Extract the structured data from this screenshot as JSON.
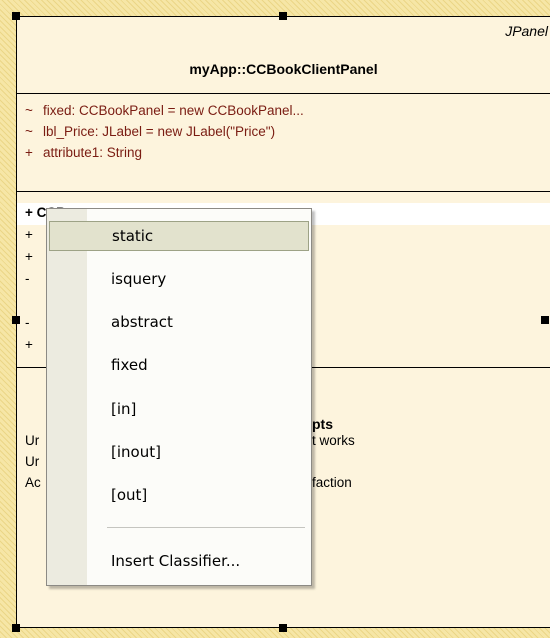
{
  "class_element": {
    "stereotype": "JPanel",
    "name": "myApp::CCBookClientPanel",
    "attributes": [
      {
        "visibility": "~",
        "text": "fixed:  CCBookPanel = new CCBookPanel..."
      },
      {
        "visibility": "~",
        "text": "lbl_Price:  JLabel = new JLabel(\"Price\")"
      },
      {
        "visibility": "+",
        "text": "attribute1:  String"
      }
    ],
    "operations_visible": [
      {
        "visibility": "+",
        "text": "CCB"
      },
      {
        "visibility": "+",
        "text": ""
      },
      {
        "visibility": "+",
        "text": ""
      },
      {
        "visibility": "-",
        "text": ""
      },
      {
        "visibility": "",
        "text": ""
      },
      {
        "visibility": "-",
        "text": ""
      },
      {
        "visibility": "+",
        "text": ""
      }
    ],
    "constraints": {
      "title_fragment": "pts",
      "lines": [
        {
          "left": "Ur",
          "right": "t works"
        },
        {
          "left": "Ur",
          "right": ""
        },
        {
          "left": "Ac",
          "right": "faction"
        }
      ]
    }
  },
  "context_menu": {
    "items": [
      {
        "label": "static",
        "selected": true
      },
      {
        "label": "isquery",
        "selected": false
      },
      {
        "label": "abstract",
        "selected": false
      },
      {
        "label": "fixed",
        "selected": false
      },
      {
        "label": "[in]",
        "selected": false
      },
      {
        "label": "[inout]",
        "selected": false
      },
      {
        "label": "[out]",
        "selected": false
      },
      {
        "label": "Insert Classifier...",
        "selected": false
      }
    ]
  },
  "colors": {
    "attribute_text": "#7a1c12",
    "menu_highlight": "#e2e2cd",
    "element_fill": "#fdf4dd"
  }
}
